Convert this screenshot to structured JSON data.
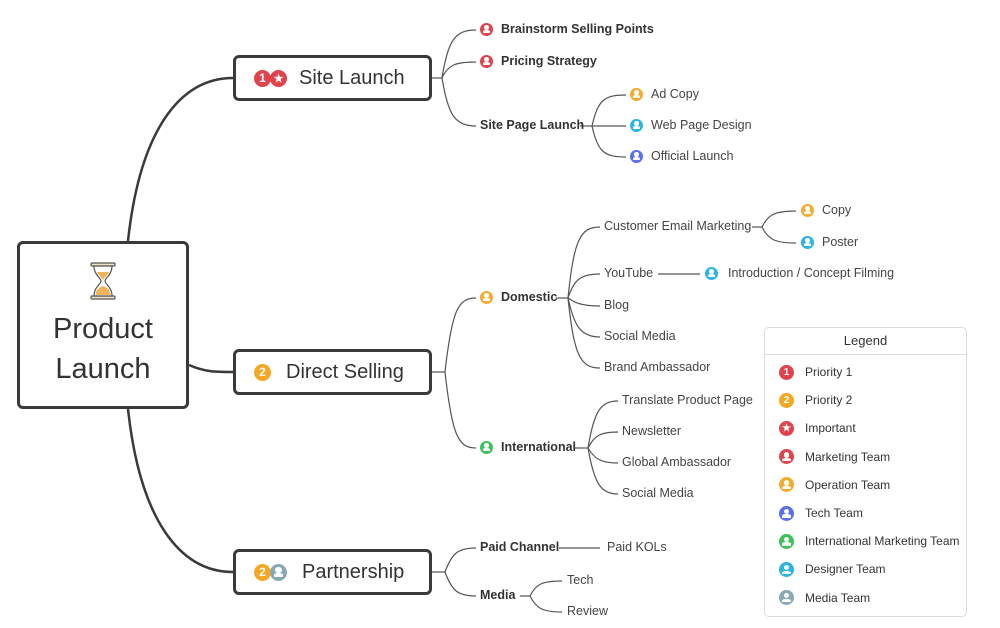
{
  "colors": {
    "priority1": "#e0434b",
    "priority2": "#f5a623",
    "important": "#e0434b",
    "marketing": "#e0434b",
    "operation": "#f5ac2e",
    "tech": "#5b6ff0",
    "international": "#3cc25a",
    "designer": "#2bb5e0",
    "media": "#86a9b3",
    "line": "#3a3a3a",
    "thin_line": "#555555"
  },
  "root": {
    "title_line1": "Product",
    "title_line2": "Launch",
    "icon": "hourglass-icon"
  },
  "branches": {
    "site_launch": {
      "label": "Site Launch",
      "markers": [
        "priority-1",
        "important"
      ],
      "children": {
        "brainstorm": {
          "label": "Brainstorm Selling Points",
          "marker": "marketing-team"
        },
        "pricing": {
          "label": "Pricing Strategy",
          "marker": "marketing-team"
        },
        "site_page_launch": {
          "label": "Site Page Launch",
          "children": {
            "ad_copy": {
              "label": "Ad Copy",
              "marker": "operation-team"
            },
            "web_design": {
              "label": "Web Page Design",
              "marker": "designer-team"
            },
            "official_launch": {
              "label": "Official Launch",
              "marker": "tech-team"
            }
          }
        }
      }
    },
    "direct_selling": {
      "label": "Direct Selling",
      "markers": [
        "priority-2"
      ],
      "children": {
        "domestic": {
          "label": "Domestic",
          "marker": "operation-team",
          "children": {
            "email": {
              "label": "Customer Email Marketing",
              "children": {
                "copy": {
                  "label": "Copy",
                  "marker": "operation-team"
                },
                "poster": {
                  "label": "Poster",
                  "marker": "designer-team"
                }
              }
            },
            "youtube": {
              "label": "YouTube",
              "children": {
                "filming": {
                  "label": "Introduction / Concept Filming",
                  "marker": "designer-team"
                }
              }
            },
            "blog": {
              "label": "Blog"
            },
            "social": {
              "label": "Social Media"
            },
            "ambassador": {
              "label": "Brand Ambassador"
            }
          }
        },
        "international": {
          "label": "International",
          "marker": "international-marketing-team",
          "children": {
            "translate": {
              "label": "Translate Product Page"
            },
            "newsletter": {
              "label": "Newsletter"
            },
            "global_ambassador": {
              "label": "Global Ambassador"
            },
            "social": {
              "label": "Social Media"
            }
          }
        }
      }
    },
    "partnership": {
      "label": "Partnership",
      "markers": [
        "priority-2",
        "media-team"
      ],
      "children": {
        "paid_channel": {
          "label": "Paid Channel",
          "children": {
            "kols": {
              "label": "Paid KOLs"
            }
          }
        },
        "media": {
          "label": "Media",
          "children": {
            "tech": {
              "label": "Tech"
            },
            "review": {
              "label": "Review"
            }
          }
        }
      }
    }
  },
  "legend": {
    "title": "Legend",
    "items": [
      {
        "label": "Priority 1",
        "marker": "priority-1",
        "glyph": "1"
      },
      {
        "label": "Priority 2",
        "marker": "priority-2",
        "glyph": "2"
      },
      {
        "label": "Important",
        "marker": "important",
        "glyph": "★"
      },
      {
        "label": "Marketing Team",
        "marker": "marketing-team"
      },
      {
        "label": "Operation Team",
        "marker": "operation-team"
      },
      {
        "label": "Tech Team",
        "marker": "tech-team"
      },
      {
        "label": "International Marketing Team",
        "marker": "international-marketing-team"
      },
      {
        "label": "Designer Team",
        "marker": "designer-team"
      },
      {
        "label": "Media Team",
        "marker": "media-team"
      }
    ]
  }
}
